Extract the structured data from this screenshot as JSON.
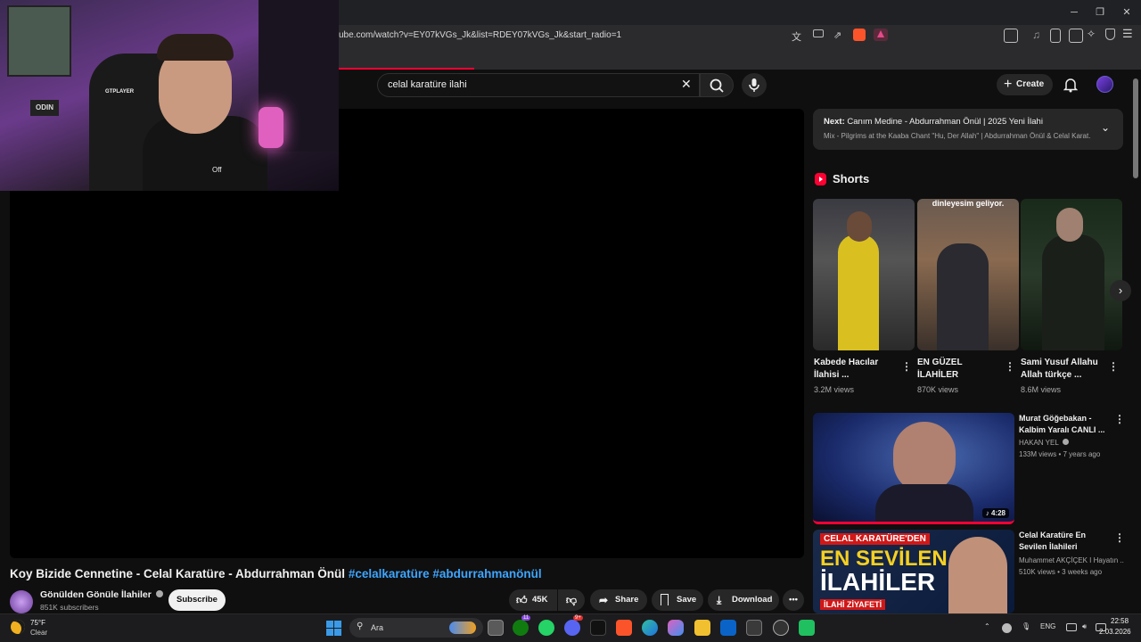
{
  "browser": {
    "url": "ube.com/watch?v=EY07kVGs_Jk&list=RDEY07kVGs_Jk&start_radio=1",
    "minimize": "─",
    "maximize": "❐",
    "close": "✕"
  },
  "header": {
    "search_value": "celal karatüre ilahi",
    "create_label": "Create"
  },
  "video": {
    "title_main": "Koy Bizide Cennetine - Celal Karatüre - Abdurrahman Önül",
    "title_tags": "#celalkaratüre #abdurrahmanönül",
    "channel_name": "Gönülden Gönüle İlahiler",
    "channel_subs": "851K subscribers",
    "subscribe_label": "Subscribe",
    "likes": "45K",
    "share_label": "Share",
    "save_label": "Save",
    "download_label": "Download"
  },
  "webcam": {
    "poster_label": "ODIN",
    "chair_label": "GTPLAYER",
    "shirt_label": "Off"
  },
  "up_next": {
    "label": "Next:",
    "title": "Canım Medine - Abdurrahman Önül | 2025 Yeni İlahi",
    "mix": "Mix - Pilgrims at the Kaaba Chant \"Hu, Der Allah\" | Abdurrahman Önül & Celal Karat..."
  },
  "shorts": {
    "heading": "Shorts",
    "items": [
      {
        "title": "Kabede Hacılar İlahisi ...",
        "views": "3.2M views",
        "overlay": ""
      },
      {
        "title": "EN GÜZEL İLAHİLER",
        "views": "870K views",
        "overlay": "dinleyesim geliyor."
      },
      {
        "title": "Sami Yusuf Allahu Allah türkçe ...",
        "views": "8.6M views",
        "overlay": ""
      }
    ]
  },
  "related": [
    {
      "title": "Murat Göğebakan - Kalbim Yaralı  CANLI ...",
      "channel": "HAKAN YEL",
      "meta": "133M views • 7 years ago",
      "duration": "4:28",
      "thumb_text": ""
    },
    {
      "title": "Celal Karatüre En Sevilen İlahileri",
      "channel": "Muhammet AKÇİÇEK I Hayatın ...",
      "meta": "510K views • 3 weeks ago",
      "duration": "",
      "thumb_text_1": "CELAL KARATÜRE'DEN",
      "thumb_text_2": "EN SEVİLEN",
      "thumb_text_3": "İLAHİLER",
      "thumb_text_4": "İLAHİ ZİYAFETİ"
    }
  ],
  "taskbar": {
    "weather_temp": "75°F",
    "weather_desc": "Clear",
    "search_placeholder": "Ara",
    "lang": "ENG",
    "time": "22:58",
    "date": "2.03.2026",
    "badge_xbox": "11",
    "badge_discord": "9+"
  },
  "colors": {
    "accent_red": "#ff0033",
    "link_blue": "#3ea6ff",
    "background": "#0f0f0f"
  }
}
